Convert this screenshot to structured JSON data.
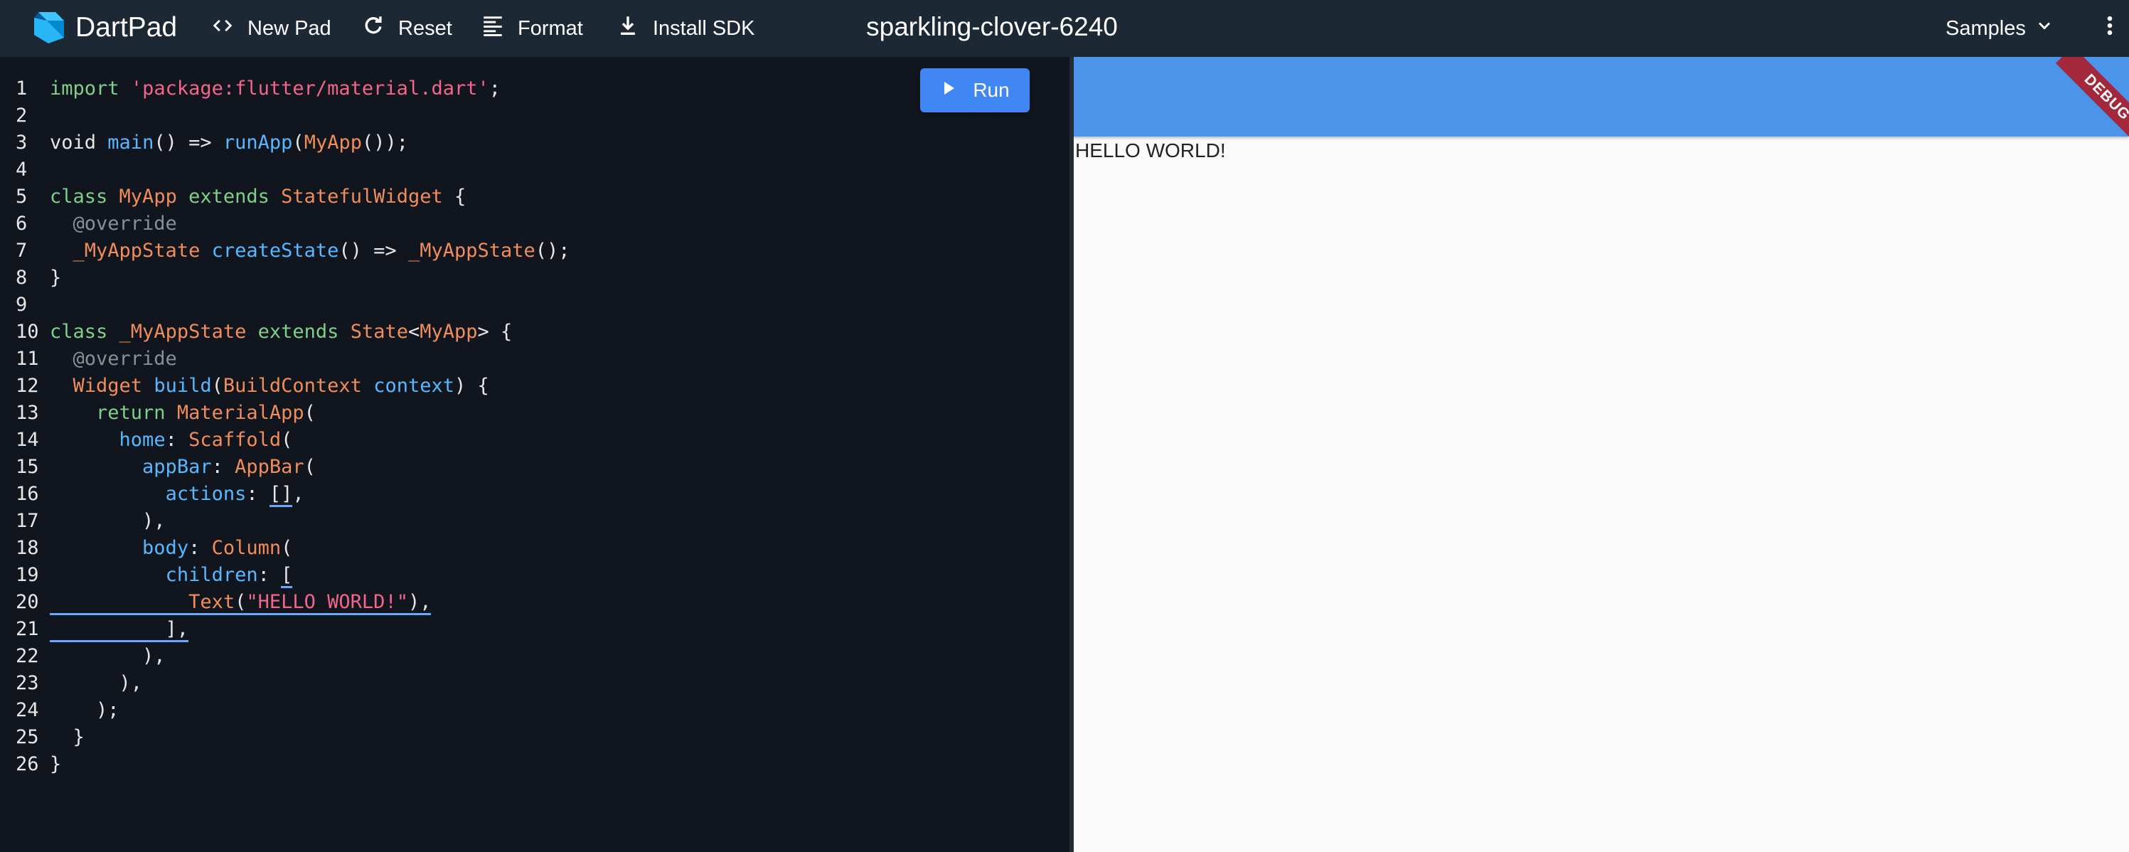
{
  "header": {
    "app_name": "DartPad",
    "new_pad_label": "New Pad",
    "reset_label": "Reset",
    "format_label": "Format",
    "install_sdk_label": "Install SDK",
    "pad_title": "sparkling-clover-6240",
    "samples_label": "Samples"
  },
  "editor": {
    "run_label": "Run",
    "line_numbers": [
      "1",
      "2",
      "3",
      "4",
      "5",
      "6",
      "7",
      "8",
      "9",
      "10",
      "11",
      "12",
      "13",
      "14",
      "15",
      "16",
      "17",
      "18",
      "19",
      "20",
      "21",
      "22",
      "23",
      "24",
      "25",
      "26"
    ]
  },
  "code": {
    "l1": [
      "import",
      " ",
      "'package:flutter/material.dart'",
      ";"
    ],
    "l3": [
      "void",
      " ",
      "main",
      "() => ",
      "runApp",
      "(",
      "MyApp",
      "());"
    ],
    "l5": [
      "class",
      " ",
      "MyApp",
      " ",
      "extends",
      " ",
      "StatefulWidget",
      " {"
    ],
    "l6": [
      "  @override"
    ],
    "l7": [
      "  ",
      "_MyAppState",
      " ",
      "createState",
      "() => ",
      "_MyAppState",
      "();"
    ],
    "l8": [
      "}"
    ],
    "l10": [
      "class",
      " ",
      "_MyAppState",
      " ",
      "extends",
      " ",
      "State",
      "<",
      "MyApp",
      "> {"
    ],
    "l11": [
      "  @override"
    ],
    "l12": [
      "  ",
      "Widget",
      " ",
      "build",
      "(",
      "BuildContext",
      " ",
      "context",
      ") {"
    ],
    "l13": [
      "    ",
      "return",
      " ",
      "MaterialApp",
      "("
    ],
    "l14": [
      "      ",
      "home",
      ": ",
      "Scaffold",
      "("
    ],
    "l15": [
      "        ",
      "appBar",
      ": ",
      "AppBar",
      "("
    ],
    "l16": [
      "          ",
      "actions",
      ": ",
      "[]",
      ","
    ],
    "l17": [
      "        ),"
    ],
    "l18": [
      "        ",
      "body",
      ": ",
      "Column",
      "("
    ],
    "l19": [
      "          ",
      "children",
      ": ",
      "["
    ],
    "l20": [
      "            ",
      "Text",
      "(",
      "\"HELLO WORLD!\"",
      "),"
    ],
    "l21": [
      "          ],"
    ],
    "l22": [
      "        ),"
    ],
    "l23": [
      "      ),"
    ],
    "l24": [
      "    );"
    ],
    "l25": [
      "  }"
    ],
    "l26": [
      "}"
    ]
  },
  "preview": {
    "text": "HELLO WORLD!",
    "debug_banner": "DEBUG"
  },
  "colors": {
    "header_bg": "#1c2834",
    "editor_bg": "#11161e",
    "run_button": "#4087f4",
    "app_bar": "#4a95ea",
    "debug_banner": "#a3283c"
  },
  "icons": [
    "dart-logo-icon",
    "code-icon",
    "refresh-icon",
    "format-icon",
    "download-icon",
    "chevron-down-icon",
    "more-vert-icon",
    "play-icon"
  ]
}
